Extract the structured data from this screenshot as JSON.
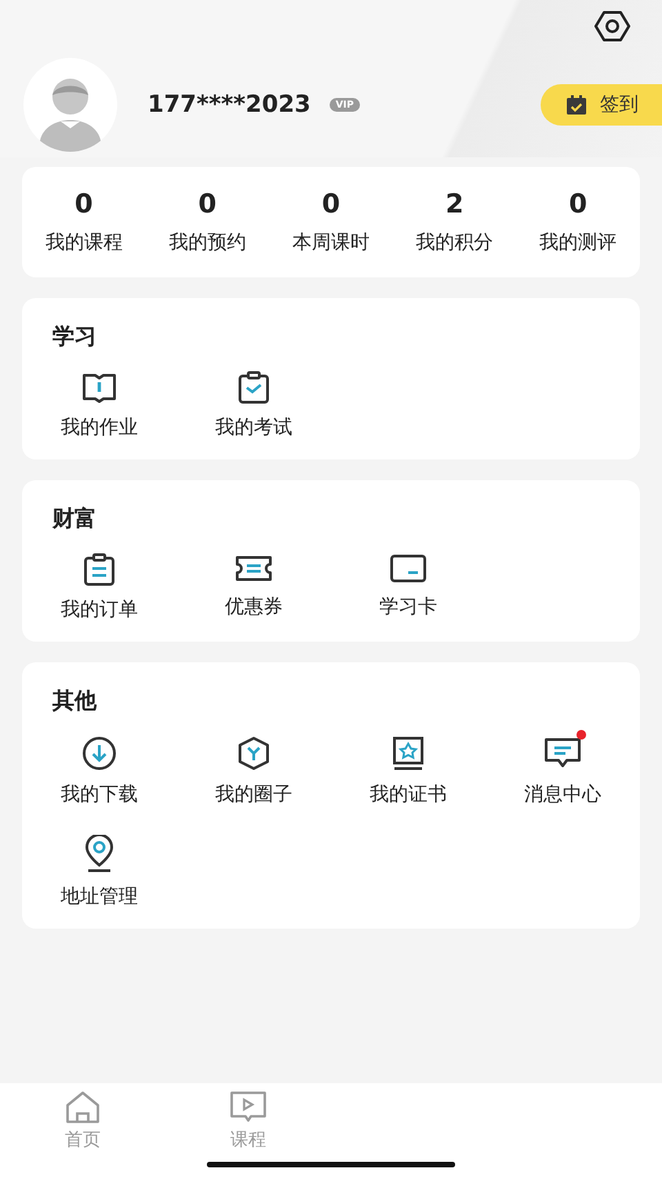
{
  "profile": {
    "phone": "177****2023",
    "badge": "VIP",
    "checkin": "签到"
  },
  "stats": [
    {
      "value": "0",
      "label": "我的课程"
    },
    {
      "value": "0",
      "label": "我的预约"
    },
    {
      "value": "0",
      "label": "本周课时"
    },
    {
      "value": "2",
      "label": "我的积分"
    },
    {
      "value": "0",
      "label": "我的测评"
    }
  ],
  "sections": [
    {
      "title": "学习",
      "items": [
        {
          "label": "我的作业",
          "kind": "book",
          "unread": false
        },
        {
          "label": "我的考试",
          "kind": "exam",
          "unread": false
        }
      ]
    },
    {
      "title": "财富",
      "items": [
        {
          "label": "我的订单",
          "kind": "order",
          "unread": false
        },
        {
          "label": "优惠券",
          "kind": "coupon",
          "unread": false
        },
        {
          "label": "学习卡",
          "kind": "card",
          "unread": false
        }
      ]
    },
    {
      "title": "其他",
      "items": [
        {
          "label": "我的下载",
          "kind": "download",
          "unread": false
        },
        {
          "label": "我的圈子",
          "kind": "circle",
          "unread": false
        },
        {
          "label": "我的证书",
          "kind": "certificate",
          "unread": false
        },
        {
          "label": "消息中心",
          "kind": "message",
          "unread": true
        },
        {
          "label": "地址管理",
          "kind": "address",
          "unread": false
        }
      ]
    }
  ],
  "tabs": [
    {
      "label": "首页",
      "kind": "home",
      "selected": false
    },
    {
      "label": "课程",
      "kind": "course",
      "selected": false
    }
  ]
}
